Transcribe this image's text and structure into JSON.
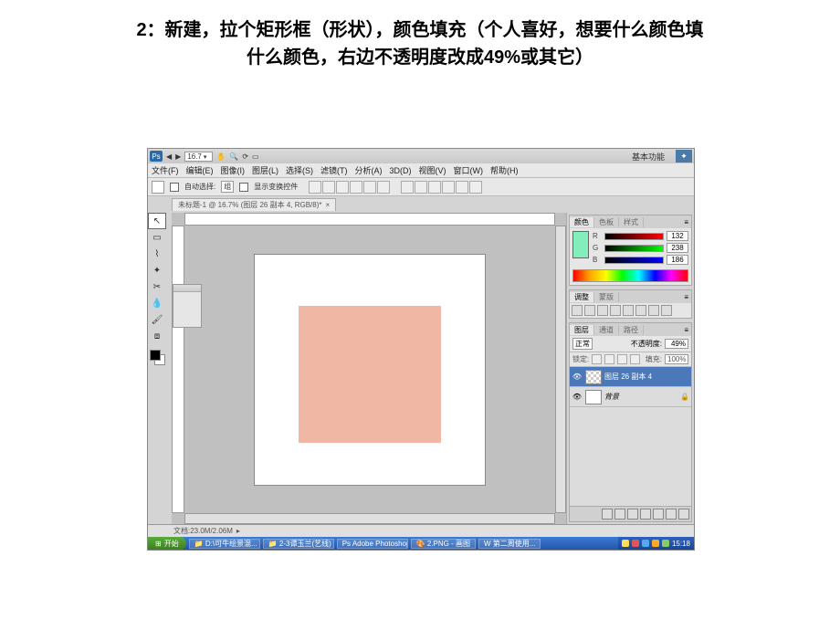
{
  "page": {
    "title_line1": "2：新建，拉个矩形框（形状），颜色填充（个人喜好，想要什么颜色填",
    "title_line2": "什么颜色，右边不透明度改成49%或其它）"
  },
  "titlebar": {
    "ps_abbr": "Ps",
    "zoom": "16.7",
    "basic_functions": "基本功能"
  },
  "menus": {
    "file": "文件(F)",
    "edit": "编辑(E)",
    "image": "图像(I)",
    "layer": "图层(L)",
    "select": "选择(S)",
    "filter": "滤镜(T)",
    "analysis": "分析(A)",
    "threeD": "3D(D)",
    "view": "视图(V)",
    "window": "窗口(W)",
    "help": "帮助(H)"
  },
  "options": {
    "auto_select": "自动选择:",
    "auto_select_val": "组",
    "show_transform": "显示变换控件"
  },
  "doc_tab": {
    "label": "未标题-1 @ 16.7% (图层 26 副本 4, RGB/8)*",
    "close": "×"
  },
  "panels": {
    "color_tab": "颜色",
    "swatch_tab": "色板",
    "style_tab": "样式",
    "r_label": "R",
    "g_label": "G",
    "b_label": "B",
    "r_val": "132",
    "g_val": "238",
    "b_val": "186",
    "adjust_tab": "调整",
    "mask_tab": "蒙版",
    "layers_tab": "图层",
    "channels_tab": "通道",
    "paths_tab": "路径",
    "blend_mode": "正常",
    "opacity_label": "不透明度:",
    "opacity_value": "49%",
    "lock_label": "锁定:",
    "fill_label": "填充:",
    "fill_value": "100%",
    "layer1_name": "图层 26 副本 4",
    "layer2_name": "背景"
  },
  "statusbar": {
    "text": "文档:23.0M/2.06M"
  },
  "taskbar": {
    "start": "开始",
    "item1": "📁 D:\\可牛绘景混...",
    "item2": "📁 2-3谭玉兰(艺线)",
    "item3": "Ps Adobe Photoshop...",
    "item4": "🎨 2.PNG - 画图",
    "item5": "W 第二周使用...",
    "clock": "15:18"
  }
}
